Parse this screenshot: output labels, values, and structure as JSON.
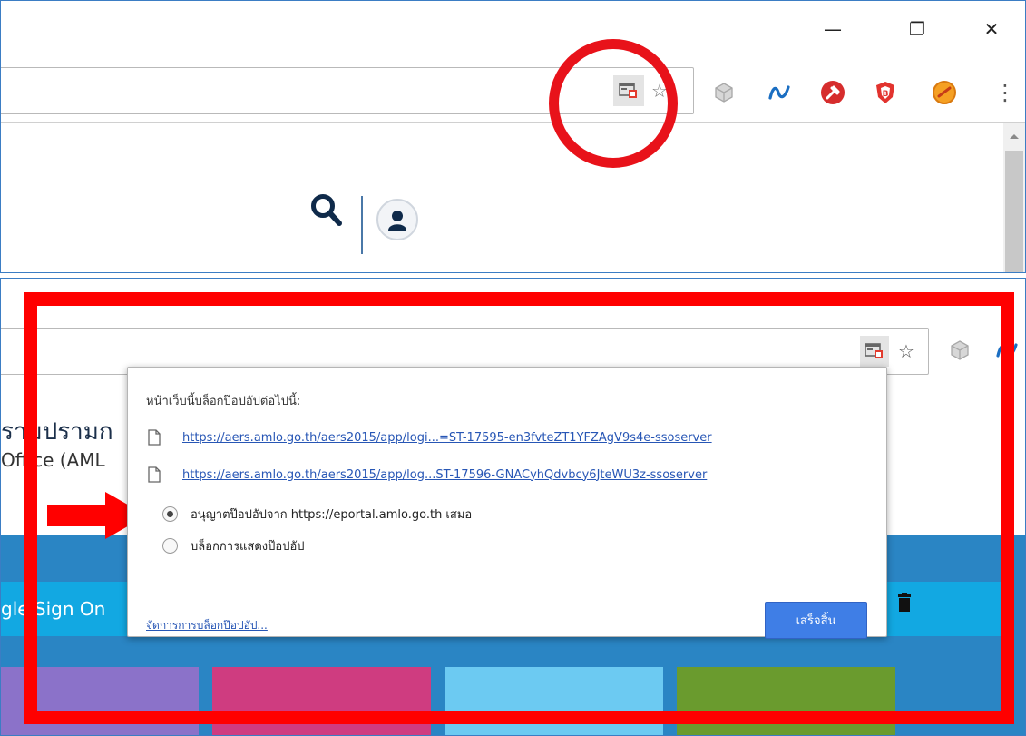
{
  "window": {
    "minimize_glyph": "—",
    "restore_glyph": "❐",
    "close_glyph": "✕"
  },
  "toolbar": {
    "blocked_popup_icon": "popup-blocked-icon",
    "bookmark_icon": "star-icon",
    "menu_glyph": "⋮",
    "extensions": [
      "cube-extension-icon",
      "wave-extension-icon",
      "red-tool-extension-icon",
      "brave-shield-extension-icon",
      "orange-compass-extension-icon"
    ]
  },
  "page_top": {
    "search_icon": "search-icon",
    "user_icon": "user-icon"
  },
  "page_bottom": {
    "heading_fragment": "รามปรามก",
    "subheading_fragment": "Office (AML",
    "sso_fragment": "gle Sign On"
  },
  "popup_bubble": {
    "title": "หน้าเว็บนี้บล็อกป๊อปอัปต่อไปนี้:",
    "links": [
      "https://aers.amlo.go.th/aers2015/app/logi...=ST-17595-en3fvteZT1YFZAgV9s4e-ssoserver",
      "https://aers.amlo.go.th/aers2015/app/log...ST-17596-GNACyhQdvbcy6JteWU3z-ssoserver"
    ],
    "options": [
      {
        "label": "อนุญาตป๊อปอัปจาก https://eportal.amlo.go.th เสมอ",
        "selected": true
      },
      {
        "label": "บล็อกการแสดงป๊อปอัป",
        "selected": false
      }
    ],
    "manage_link": "จัดการการบล็อกป๊อปอัป...",
    "done_button": "เสร็จสิ้น"
  },
  "annotation_colors": {
    "highlight": "#e8121a",
    "frame": "#ff0000"
  }
}
